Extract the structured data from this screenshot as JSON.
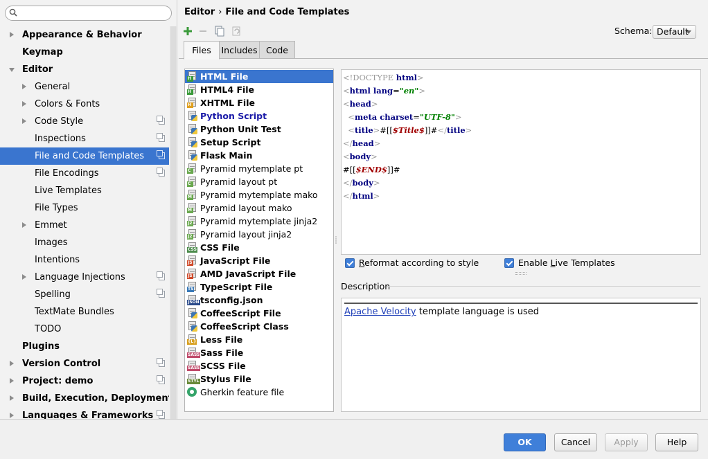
{
  "search": {
    "placeholder": ""
  },
  "sidebar": {
    "items": [
      {
        "label": "Appearance & Behavior",
        "bold": true,
        "arrow": "right",
        "indent": 0,
        "config": false,
        "selected": false
      },
      {
        "label": "Keymap",
        "bold": true,
        "arrow": "none",
        "indent": 0,
        "config": false,
        "selected": false
      },
      {
        "label": "Editor",
        "bold": true,
        "arrow": "down",
        "indent": 0,
        "config": false,
        "selected": false
      },
      {
        "label": "General",
        "bold": false,
        "arrow": "right",
        "indent": 1,
        "config": false,
        "selected": false
      },
      {
        "label": "Colors & Fonts",
        "bold": false,
        "arrow": "right",
        "indent": 1,
        "config": false,
        "selected": false
      },
      {
        "label": "Code Style",
        "bold": false,
        "arrow": "right",
        "indent": 1,
        "config": true,
        "selected": false
      },
      {
        "label": "Inspections",
        "bold": false,
        "arrow": "none",
        "indent": 1,
        "config": true,
        "selected": false
      },
      {
        "label": "File and Code Templates",
        "bold": false,
        "arrow": "none",
        "indent": 1,
        "config": true,
        "selected": true
      },
      {
        "label": "File Encodings",
        "bold": false,
        "arrow": "none",
        "indent": 1,
        "config": true,
        "selected": false
      },
      {
        "label": "Live Templates",
        "bold": false,
        "arrow": "none",
        "indent": 1,
        "config": false,
        "selected": false
      },
      {
        "label": "File Types",
        "bold": false,
        "arrow": "none",
        "indent": 1,
        "config": false,
        "selected": false
      },
      {
        "label": "Emmet",
        "bold": false,
        "arrow": "right",
        "indent": 1,
        "config": false,
        "selected": false
      },
      {
        "label": "Images",
        "bold": false,
        "arrow": "none",
        "indent": 1,
        "config": false,
        "selected": false
      },
      {
        "label": "Intentions",
        "bold": false,
        "arrow": "none",
        "indent": 1,
        "config": false,
        "selected": false
      },
      {
        "label": "Language Injections",
        "bold": false,
        "arrow": "right",
        "indent": 1,
        "config": true,
        "selected": false
      },
      {
        "label": "Spelling",
        "bold": false,
        "arrow": "none",
        "indent": 1,
        "config": true,
        "selected": false
      },
      {
        "label": "TextMate Bundles",
        "bold": false,
        "arrow": "none",
        "indent": 1,
        "config": false,
        "selected": false
      },
      {
        "label": "TODO",
        "bold": false,
        "arrow": "none",
        "indent": 1,
        "config": false,
        "selected": false
      },
      {
        "label": "Plugins",
        "bold": true,
        "arrow": "none",
        "indent": 0,
        "config": false,
        "selected": false
      },
      {
        "label": "Version Control",
        "bold": true,
        "arrow": "right",
        "indent": 0,
        "config": true,
        "selected": false
      },
      {
        "label": "Project: demo",
        "bold": true,
        "arrow": "right",
        "indent": 0,
        "config": true,
        "selected": false
      },
      {
        "label": "Build, Execution, Deployment",
        "bold": true,
        "arrow": "right",
        "indent": 0,
        "config": false,
        "selected": false
      },
      {
        "label": "Languages & Frameworks",
        "bold": true,
        "arrow": "right",
        "indent": 0,
        "config": true,
        "selected": false
      }
    ]
  },
  "breadcrumb": {
    "parent": "Editor",
    "separator": "›",
    "current": "File and Code Templates"
  },
  "toolbar": {
    "icons": [
      "add-icon",
      "remove-icon",
      "copy-icon",
      "reset-icon"
    ]
  },
  "schema": {
    "label": "Schema:",
    "value": "Default"
  },
  "tabs": [
    {
      "label": "Files",
      "active": true
    },
    {
      "label": "Includes",
      "active": false
    },
    {
      "label": "Code",
      "active": false
    }
  ],
  "templates": [
    {
      "name": "HTML File",
      "badge": "H",
      "badge_color": "#3a9a3a",
      "style": "bold",
      "selected": true
    },
    {
      "name": "HTML4 File",
      "badge": "H",
      "badge_color": "#3a9a3a",
      "style": "bold",
      "selected": false
    },
    {
      "name": "XHTML File",
      "badge": "H",
      "badge_color": "#e0a020",
      "style": "bold",
      "selected": false
    },
    {
      "name": "Python Script",
      "badge": "py",
      "badge_color": "#3d75b3",
      "style": "bold-blue",
      "selected": false
    },
    {
      "name": "Python Unit Test",
      "badge": "py",
      "badge_color": "#3d75b3",
      "style": "bold",
      "selected": false
    },
    {
      "name": "Setup Script",
      "badge": "py",
      "badge_color": "#3d75b3",
      "style": "bold",
      "selected": false
    },
    {
      "name": "Flask Main",
      "badge": "py",
      "badge_color": "#3d75b3",
      "style": "bold",
      "selected": false
    },
    {
      "name": "Pyramid mytemplate pt",
      "badge": "C",
      "badge_color": "#6aa84f",
      "style": "normal",
      "selected": false
    },
    {
      "name": "Pyramid layout pt",
      "badge": "C",
      "badge_color": "#6aa84f",
      "style": "normal",
      "selected": false
    },
    {
      "name": "Pyramid mytemplate mako",
      "badge": "M",
      "badge_color": "#6aa84f",
      "style": "normal",
      "selected": false
    },
    {
      "name": "Pyramid layout mako",
      "badge": "M",
      "badge_color": "#6aa84f",
      "style": "normal",
      "selected": false
    },
    {
      "name": "Pyramid mytemplate jinja2",
      "badge": "J2",
      "badge_color": "#6aa84f",
      "style": "normal",
      "selected": false
    },
    {
      "name": "Pyramid layout jinja2",
      "badge": "J2",
      "badge_color": "#6aa84f",
      "style": "normal",
      "selected": false
    },
    {
      "name": "CSS File",
      "badge": "CSS",
      "badge_color": "#4a8a4a",
      "style": "bold",
      "selected": false
    },
    {
      "name": "JavaScript File",
      "badge": "JS",
      "badge_color": "#d04a2a",
      "style": "bold",
      "selected": false
    },
    {
      "name": "AMD JavaScript File",
      "badge": "JS",
      "badge_color": "#d04a2a",
      "style": "bold",
      "selected": false
    },
    {
      "name": "TypeScript File",
      "badge": "TS",
      "badge_color": "#3a7ab8",
      "style": "bold",
      "selected": false
    },
    {
      "name": "tsconfig.json",
      "badge": "JSON",
      "badge_color": "#2a4a8a",
      "style": "bold",
      "selected": false
    },
    {
      "name": "CoffeeScript File",
      "badge": "py",
      "badge_color": "#3d75b3",
      "style": "bold",
      "selected": false
    },
    {
      "name": "CoffeeScript Class",
      "badge": "py",
      "badge_color": "#3d75b3",
      "style": "bold",
      "selected": false
    },
    {
      "name": "Less File",
      "badge": "{L}",
      "badge_color": "#d8a020",
      "style": "bold",
      "selected": false
    },
    {
      "name": "Sass File",
      "badge": "SASS",
      "badge_color": "#c04a6a",
      "style": "bold",
      "selected": false
    },
    {
      "name": "SCSS File",
      "badge": "SASS",
      "badge_color": "#c04a6a",
      "style": "bold",
      "selected": false
    },
    {
      "name": "Stylus File",
      "badge": "STYL",
      "badge_color": "#6a8a3a",
      "style": "bold",
      "selected": false
    },
    {
      "name": "Gherkin feature file",
      "badge": "gherkin",
      "badge_color": "#35a46a",
      "style": "normal",
      "selected": false
    }
  ],
  "editor": {
    "lines": [
      [
        {
          "t": "<!DOCTYPE ",
          "c": "br"
        },
        {
          "t": "html",
          "c": "kw"
        },
        {
          "t": ">",
          "c": "br"
        }
      ],
      [
        {
          "t": "<",
          "c": "br"
        },
        {
          "t": "html ",
          "c": "tg"
        },
        {
          "t": "lang",
          "c": "tg"
        },
        {
          "t": "=",
          "c": ""
        },
        {
          "t": "\"en\"",
          "c": "av"
        },
        {
          "t": ">",
          "c": "br"
        }
      ],
      [
        {
          "t": "<",
          "c": "br"
        },
        {
          "t": "head",
          "c": "tg"
        },
        {
          "t": ">",
          "c": "br"
        }
      ],
      [
        {
          "t": "  <",
          "c": "br"
        },
        {
          "t": "meta ",
          "c": "tg"
        },
        {
          "t": "charset",
          "c": "tg"
        },
        {
          "t": "=",
          "c": ""
        },
        {
          "t": "\"UTF-8\"",
          "c": "av"
        },
        {
          "t": ">",
          "c": "br"
        }
      ],
      [
        {
          "t": "  <",
          "c": "br"
        },
        {
          "t": "title",
          "c": "tg"
        },
        {
          "t": ">",
          "c": "br"
        },
        {
          "t": "#[[",
          "c": ""
        },
        {
          "t": "$Title$",
          "c": "vv"
        },
        {
          "t": "]]#",
          "c": ""
        },
        {
          "t": "</",
          "c": "br"
        },
        {
          "t": "title",
          "c": "tg"
        },
        {
          "t": ">",
          "c": "br"
        }
      ],
      [
        {
          "t": "</",
          "c": "br"
        },
        {
          "t": "head",
          "c": "tg"
        },
        {
          "t": ">",
          "c": "br"
        }
      ],
      [
        {
          "t": "<",
          "c": "br"
        },
        {
          "t": "body",
          "c": "tg"
        },
        {
          "t": ">",
          "c": "br"
        }
      ],
      [
        {
          "t": "#[[",
          "c": ""
        },
        {
          "t": "$END$",
          "c": "vv"
        },
        {
          "t": "]]#",
          "c": ""
        }
      ],
      [
        {
          "t": "</",
          "c": "br"
        },
        {
          "t": "body",
          "c": "tg"
        },
        {
          "t": ">",
          "c": "br"
        }
      ],
      [
        {
          "t": "</",
          "c": "br"
        },
        {
          "t": "html",
          "c": "tg"
        },
        {
          "t": ">",
          "c": "br"
        }
      ]
    ]
  },
  "options": {
    "reformat": {
      "pre": "",
      "mnemonic": "R",
      "post": "eformat according to style",
      "checked": true
    },
    "live_templates": {
      "pre": "Enable ",
      "mnemonic": "L",
      "post": "ive Templates",
      "checked": true
    }
  },
  "description": {
    "label": "Description",
    "link": "Apache Velocity",
    "text": " template language is used"
  },
  "buttons": {
    "ok": "OK",
    "cancel": "Cancel",
    "apply": "Apply",
    "help": "Help"
  },
  "colors": {
    "selection": "#3a75cf",
    "accent": "#3f7fd9"
  }
}
